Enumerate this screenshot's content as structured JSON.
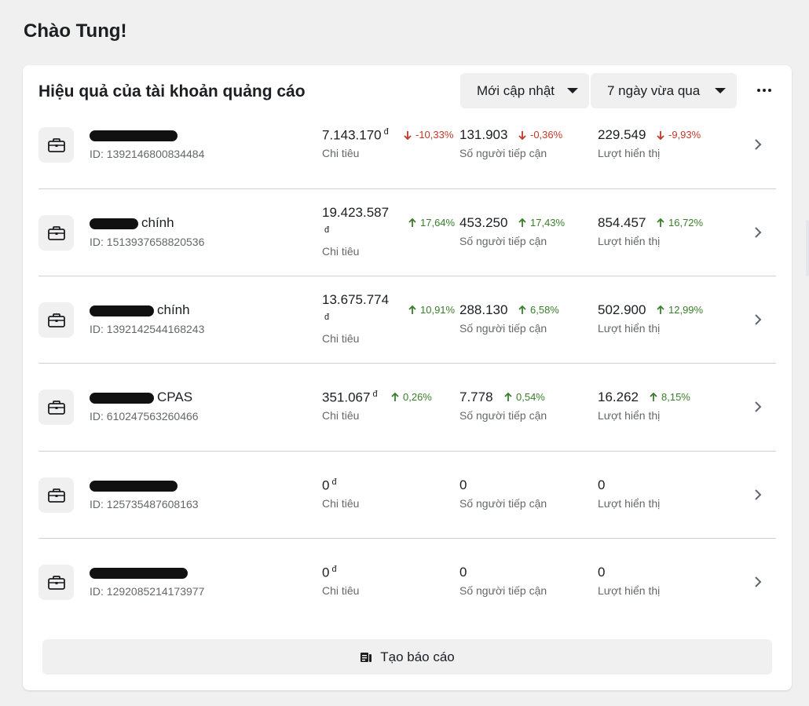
{
  "greeting": "Chào Tung!",
  "card": {
    "title": "Hiệu quả của tài khoản quảng cáo",
    "sort_dropdown": "Mới cập nhật",
    "range_dropdown": "7 ngày vừa qua",
    "more_icon": "more-horizontal-icon"
  },
  "labels": {
    "spend": "Chi tiêu",
    "reach": "Số người tiếp cận",
    "impressions": "Lượt hiển thị",
    "currency": "đ"
  },
  "accounts": [
    {
      "name": "",
      "id": "ID: 1392146800834484",
      "spend": "7.143.170",
      "spend_delta": "-10,33%",
      "spend_dir": "down",
      "reach": "131.903",
      "reach_delta": "-0,36%",
      "reach_dir": "down",
      "impressions": "229.549",
      "impressions_delta": "-9,93%",
      "impressions_dir": "down"
    },
    {
      "name": "chính",
      "id": "ID: 1513937658820536",
      "spend": "19.423.587",
      "spend_delta": "17,64%",
      "spend_dir": "up",
      "reach": "453.250",
      "reach_delta": "17,43%",
      "reach_dir": "up",
      "impressions": "854.457",
      "impressions_delta": "16,72%",
      "impressions_dir": "up"
    },
    {
      "name": "chính",
      "id": "ID: 1392142544168243",
      "spend": "13.675.774",
      "spend_delta": "10,91%",
      "spend_dir": "up",
      "reach": "288.130",
      "reach_delta": "6,58%",
      "reach_dir": "up",
      "impressions": "502.900",
      "impressions_delta": "12,99%",
      "impressions_dir": "up"
    },
    {
      "name": "CPAS",
      "id": "ID: 610247563260466",
      "spend": "351.067",
      "spend_delta": "0,26%",
      "spend_dir": "up",
      "reach": "7.778",
      "reach_delta": "0,54%",
      "reach_dir": "up",
      "impressions": "16.262",
      "impressions_delta": "8,15%",
      "impressions_dir": "up"
    },
    {
      "name": "",
      "id": "ID: 125735487608163",
      "spend": "0",
      "spend_delta": "",
      "spend_dir": "",
      "reach": "0",
      "reach_delta": "",
      "reach_dir": "",
      "impressions": "0",
      "impressions_delta": "",
      "impressions_dir": ""
    },
    {
      "name": "",
      "id": "ID: 1292085214173977",
      "spend": "0",
      "spend_delta": "",
      "spend_dir": "",
      "reach": "0",
      "reach_delta": "",
      "reach_dir": "",
      "impressions": "0",
      "impressions_delta": "",
      "impressions_dir": ""
    }
  ],
  "report_button": "Tạo báo cáo",
  "colors": {
    "up": "#3a7d2c",
    "down": "#c0392b",
    "background": "#f0f0f0"
  }
}
